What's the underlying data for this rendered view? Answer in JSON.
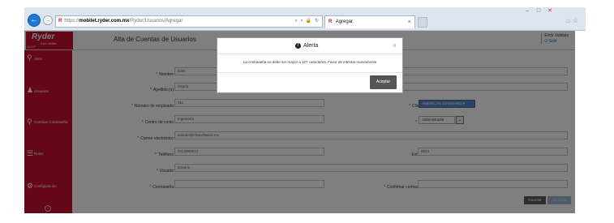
{
  "browser": {
    "url": "https://mobilet.ryder.com.mx/Ryder/Usuarios/Agregar",
    "url_prefix": "https://",
    "url_host": "mobilet.ryder.com.mx",
    "url_path": "/Ryder/Usuarios/Agregar",
    "tab_title": "Agregar",
    "url_tools": "⌕ ▾ 🔒 ↻",
    "window_controls": [
      "–",
      "□",
      "✕"
    ]
  },
  "header": {
    "logo_word": "Ryder",
    "logo_tag": "Ever better.",
    "version": "v1.0.7",
    "page_title": "Alta de Cuentas de Usuarios",
    "user_name": "Erick Valdivia",
    "logout_label": "Salir"
  },
  "sidebar": {
    "items": [
      {
        "label": "Visor",
        "icon": "map-marker-icon"
      },
      {
        "label": "Usuarios",
        "icon": "users-icon"
      },
      {
        "label": "Cambiar Contraseña",
        "icon": "key-icon"
      },
      {
        "label": "Roles",
        "icon": "list-icon"
      },
      {
        "label": "Configuración",
        "icon": "gear-icon"
      }
    ],
    "collapse_icon": "chevron-left-icon"
  },
  "form": {
    "required_mark": "*",
    "fields": {
      "nombre": {
        "label": "Nombre",
        "value": "Eder"
      },
      "apellido": {
        "label": "Apellido (s)",
        "value": "Osorio"
      },
      "numero_empleado": {
        "label": "Número de empleado",
        "value": "011"
      },
      "cliente": {
        "label": "Cliente:",
        "value": "AMERICAN STANDARD ▾"
      },
      "centro_costo": {
        "label": "Centro de costo",
        "value": "Ingeniería"
      },
      "rol": {
        "label": "Rol:",
        "value": "Administrador"
      },
      "correo": {
        "label": "Correo electrónico",
        "value": "eosorio@chasoftware.mx"
      },
      "telefono": {
        "label": "Teléfono",
        "value": "3313260613"
      },
      "ext": {
        "label": "Ext.",
        "value": "6923"
      },
      "usuario": {
        "label": "Usuario",
        "value": "Eosorio"
      },
      "contrasena": {
        "label": "Contraseña",
        "value": ""
      },
      "confirmar_contrasena": {
        "label": "Confirmar contraseña",
        "value": ""
      }
    },
    "save_label": "Guardar",
    "cancel_label": "Cancelar"
  },
  "modal": {
    "title": "Alerta",
    "icon": "exclamation-icon",
    "message": "La contraseña no debe ser mayor a 127 caracteres. Favor de intentar nuevamente",
    "accept_label": "Aceptar",
    "close_symbol": "×"
  },
  "colors": {
    "brand_red": "#c8102e",
    "overlay": "rgba(0,0,0,0.5)",
    "accent_blue": "#5a86c2"
  }
}
